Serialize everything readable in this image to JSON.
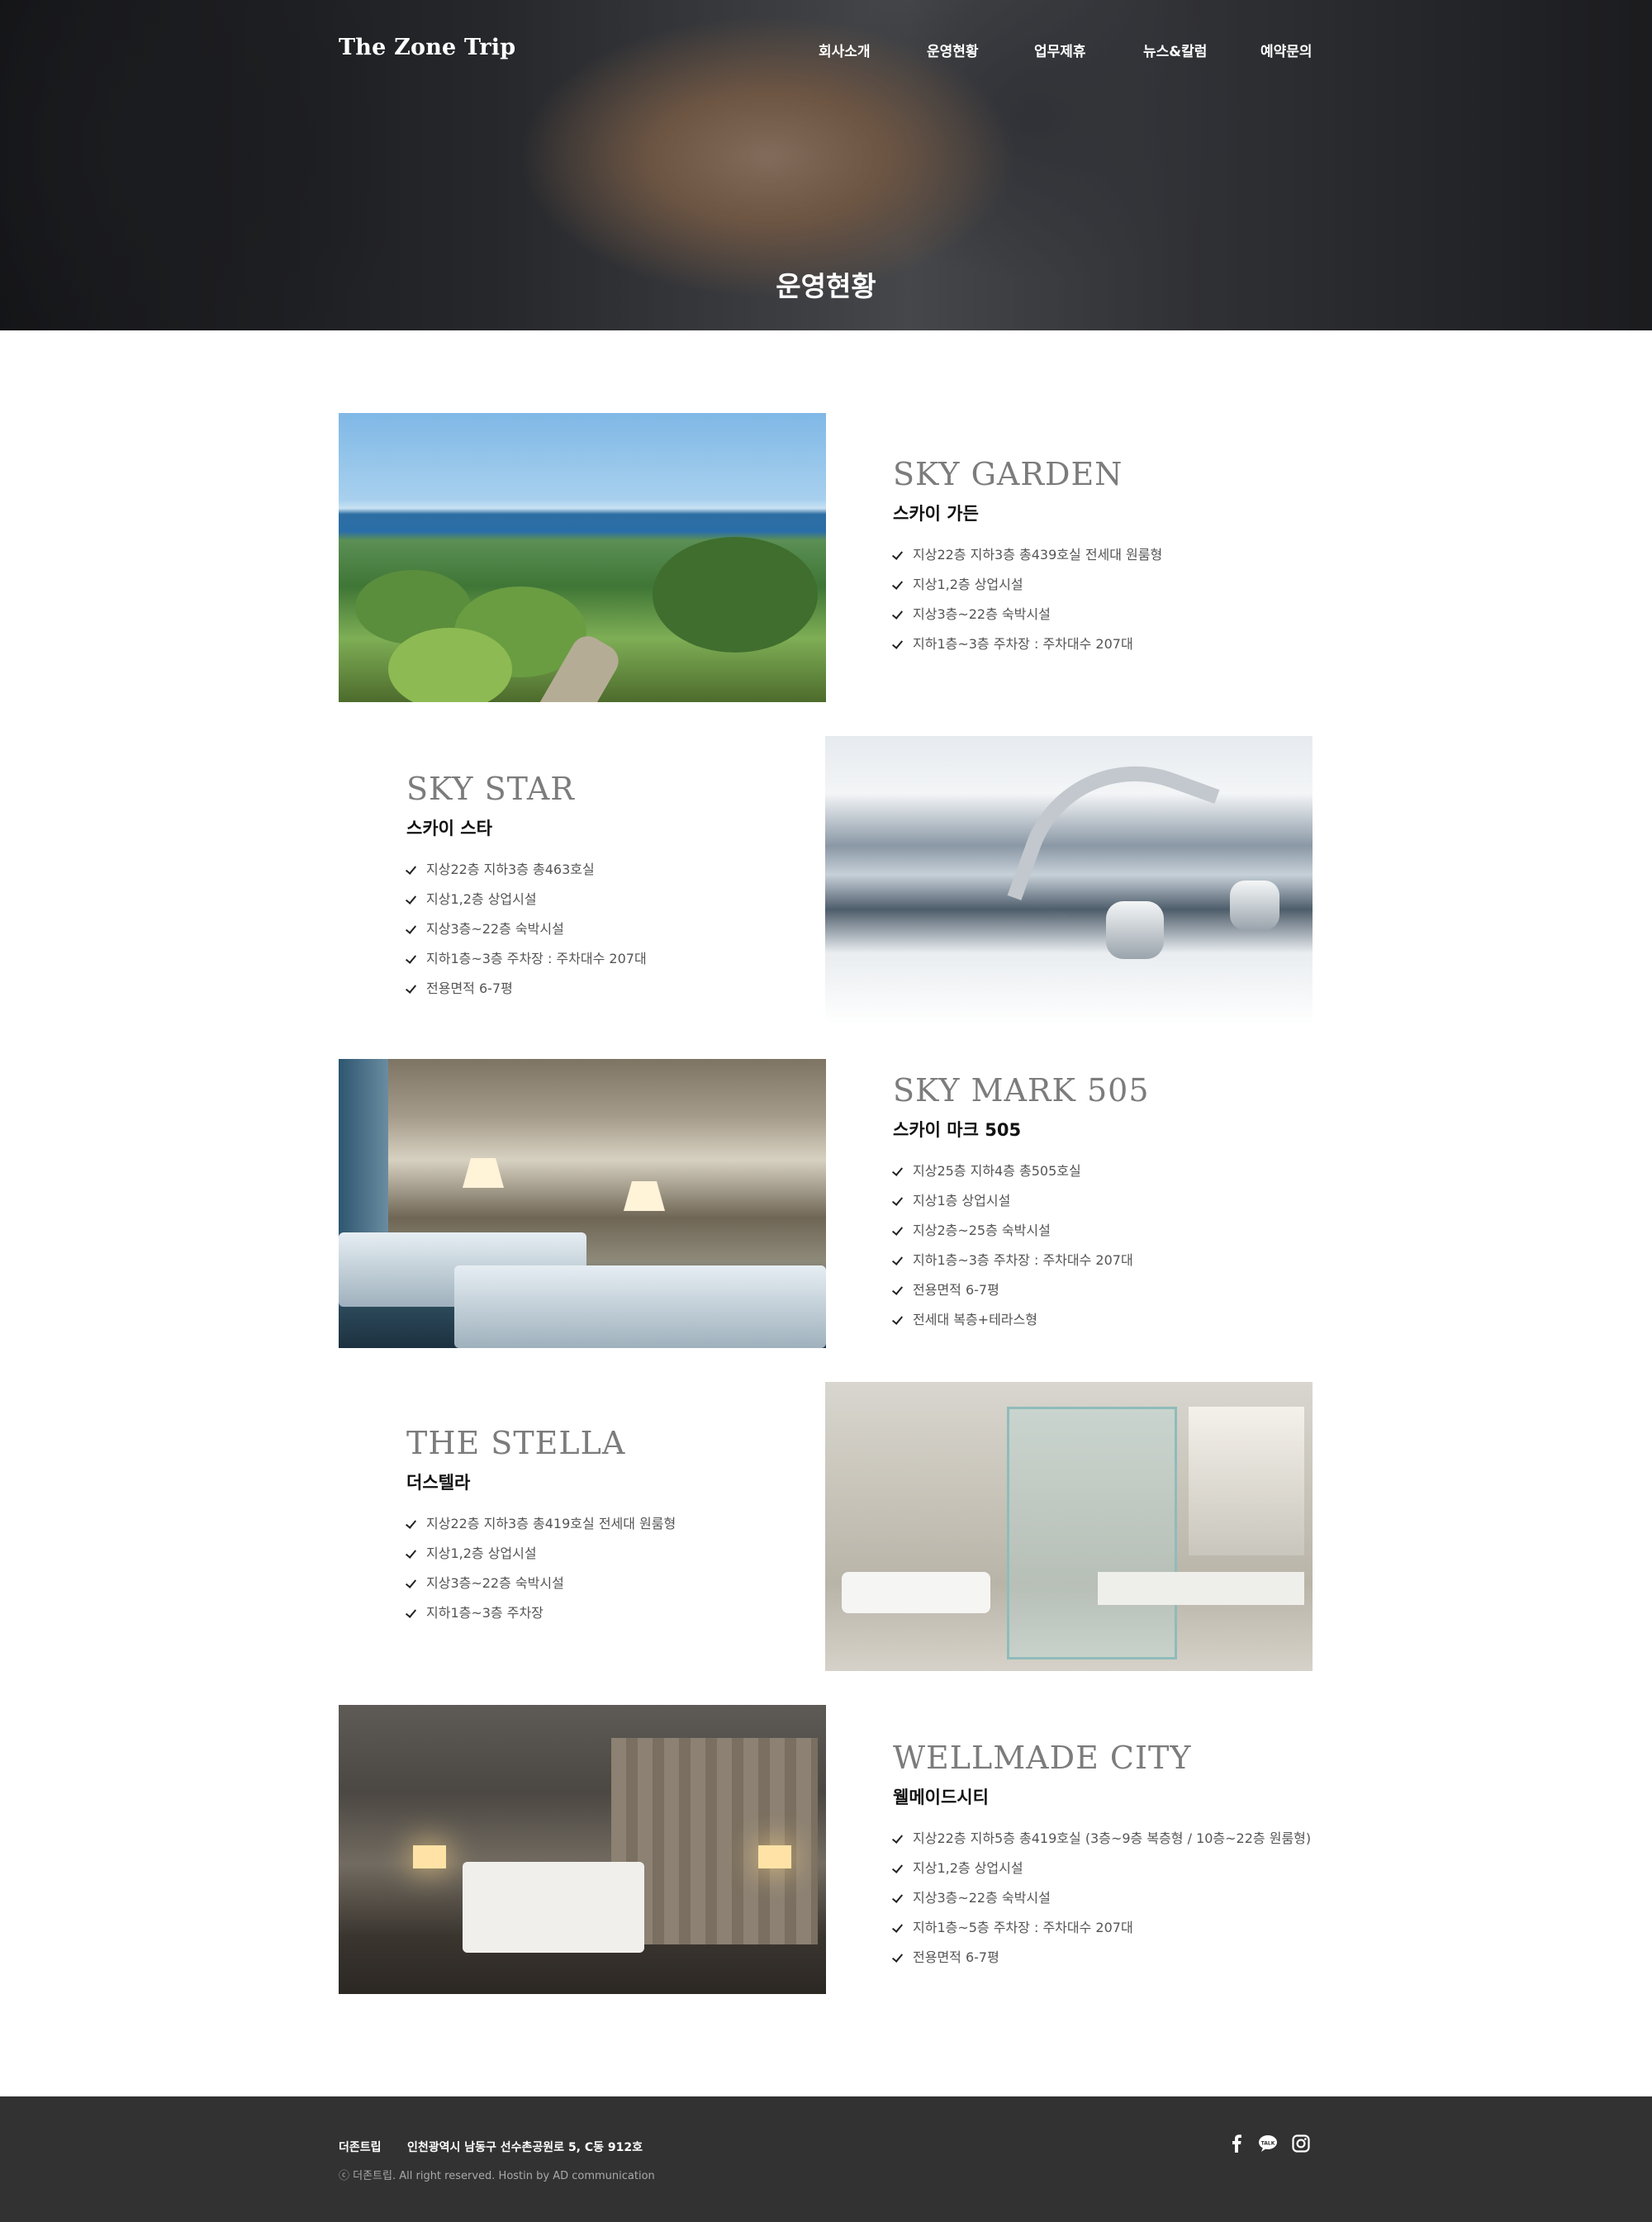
{
  "header": {
    "logo": "The Zone Trip",
    "nav": [
      {
        "label": "회사소개"
      },
      {
        "label": "운영현황"
      },
      {
        "label": "업무제휴"
      },
      {
        "label": "뉴스&칼럼"
      },
      {
        "label": "예약문의"
      }
    ],
    "hero_title": "운영현황"
  },
  "properties": [
    {
      "title_en": "SKY GARDEN",
      "title_ko": "스카이 가든",
      "features": [
        "지상22층 지하3층 총439호실 전세대 원룸형",
        "지상1,2층 상업시설",
        "지상3층~22층 숙박시설",
        "지하1층~3층 주차장 : 주차대수 207대"
      ]
    },
    {
      "title_en": "SKY STAR",
      "title_ko": "스카이 스타",
      "features": [
        "지상22층 지하3층 총463호실",
        "지상1,2층 상업시설",
        "지상3층~22층 숙박시설",
        "지하1층~3층 주차장 : 주차대수 207대",
        "전용면적 6-7평"
      ]
    },
    {
      "title_en": "SKY MARK 505",
      "title_ko": "스카이 마크 505",
      "features": [
        "지상25층 지하4층 총505호실",
        "지상1층 상업시설",
        "지상2층~25층 숙박시설",
        "지하1층~3층 주차장 : 주차대수 207대",
        "전용면적 6-7평",
        "전세대 복층+테라스형"
      ]
    },
    {
      "title_en": "THE STELLA",
      "title_ko": "더스텔라",
      "features": [
        "지상22층 지하3층 총419호실 전세대 원룸형",
        "지상1,2층 상업시설",
        "지상3층~22층 숙박시설",
        "지하1층~3층 주차장"
      ]
    },
    {
      "title_en": "WELLMADE CITY",
      "title_ko": "웰메이드시티",
      "features": [
        "지상22층 지하5층 총419호실 (3층~9층 복층형 / 10층~22층 원룸형)",
        "지상1,2층 상업시설",
        "지상3층~22층 숙박시설",
        "지하1층~5층 주차장 : 주차대수 207대",
        "전용면적 6-7평"
      ]
    }
  ],
  "footer": {
    "company": "더존트립",
    "address": "인천광역시 남동구 선수촌공원로 5, C동 912호",
    "copyright": "ⓒ 더존트립. All right reserved. Hostin by AD communication",
    "social": [
      {
        "icon": "facebook-icon"
      },
      {
        "icon": "kakaotalk-icon"
      },
      {
        "icon": "instagram-icon"
      }
    ]
  }
}
